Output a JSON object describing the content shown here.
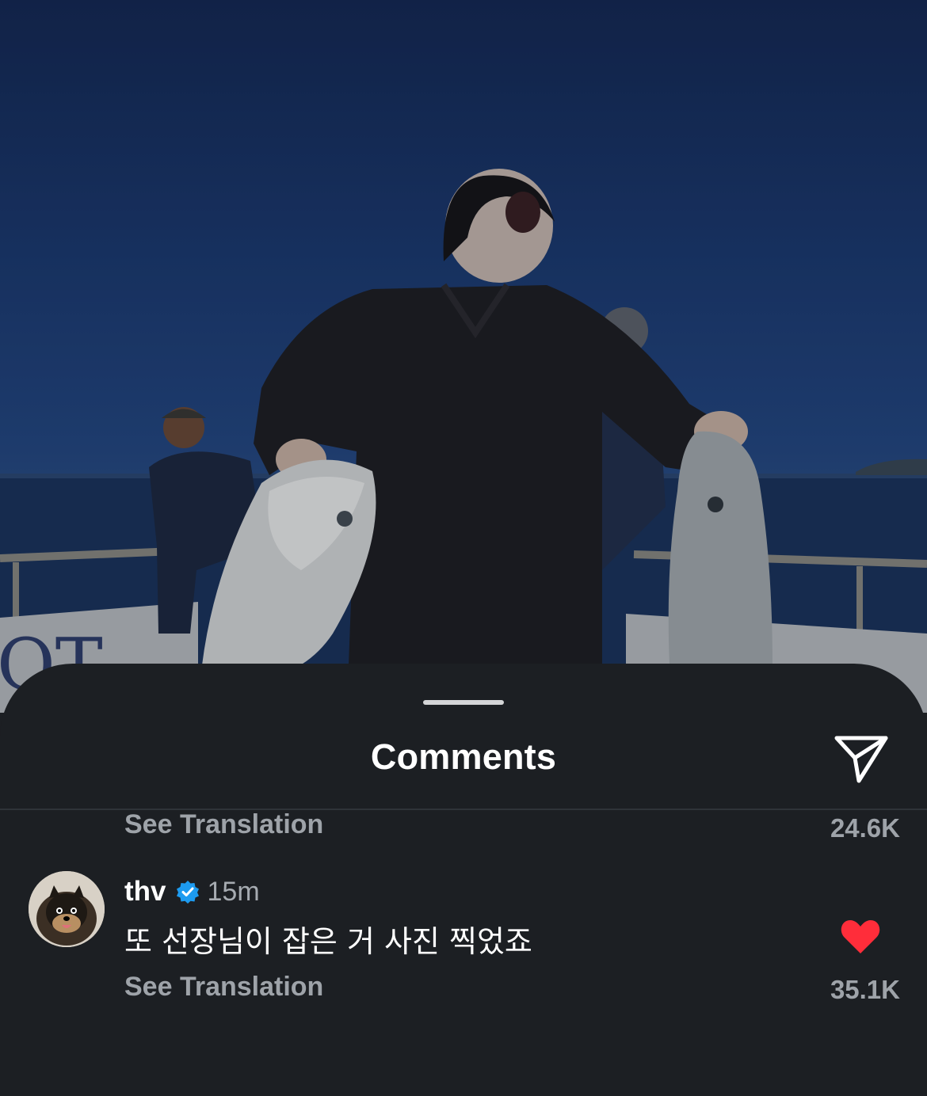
{
  "sheet": {
    "title": "Comments",
    "share_icon": "paper-plane-icon"
  },
  "comments": [
    {
      "translation_label": "See Translation",
      "like_count": "24.6K"
    },
    {
      "username": "thv",
      "verified": true,
      "time": "15m",
      "text": "또 선장님이 잡은 거 사진 찍었죠",
      "translation_label": "See Translation",
      "liked": true,
      "like_count": "35.1K"
    }
  ],
  "colors": {
    "sheet_background": "#1c1f23",
    "secondary_text": "#9ea3a9",
    "verified_badge": "#1d9bf0",
    "like_heart": "#ff2d3a"
  }
}
